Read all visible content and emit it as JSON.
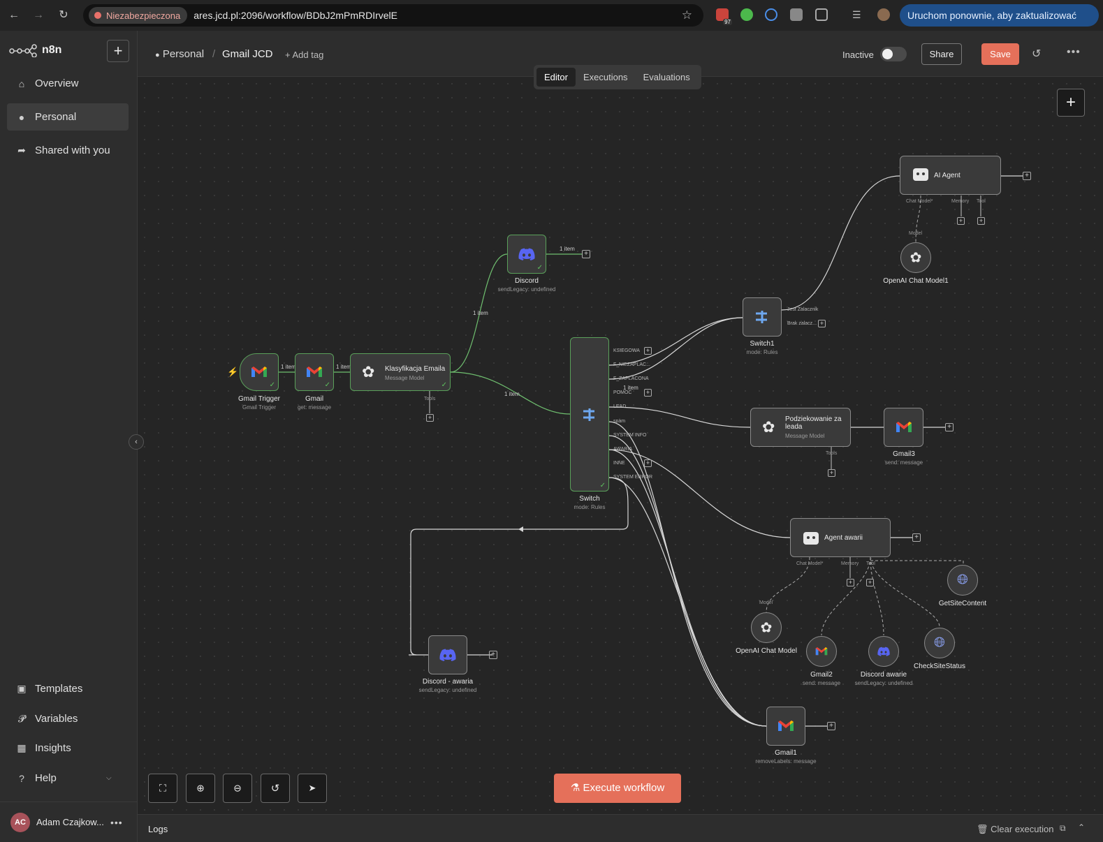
{
  "browser": {
    "insecure_label": "Niezabezpieczona",
    "url": "ares.jcd.pl:2096/workflow/BDbJ2mPmRDIrvelE",
    "update_button": "Uruchom ponownie, aby zaktualizować",
    "ext_badge": "97"
  },
  "sidebar": {
    "brand": "n8n",
    "items": [
      {
        "label": "Overview",
        "icon": "home-icon"
      },
      {
        "label": "Personal",
        "icon": "user-icon"
      },
      {
        "label": "Shared with you",
        "icon": "share-icon"
      }
    ],
    "bottom_items": [
      {
        "label": "Templates",
        "icon": "templates-icon"
      },
      {
        "label": "Variables",
        "icon": "variables-icon"
      },
      {
        "label": "Insights",
        "icon": "insights-icon"
      },
      {
        "label": "Help",
        "icon": "help-icon"
      }
    ],
    "user": {
      "initials": "AC",
      "name": "Adam Czajkow..."
    }
  },
  "header": {
    "breadcrumb_project": "Personal",
    "separator": "/",
    "workflow_name": "Gmail JCD",
    "add_tag": "+ Add tag",
    "status_label": "Inactive",
    "share_label": "Share",
    "save_label": "Save"
  },
  "tabs": [
    "Editor",
    "Executions",
    "Evaluations"
  ],
  "nodes": {
    "gmail_trigger": {
      "title": "Gmail Trigger",
      "sub": "Gmail Trigger"
    },
    "gmail": {
      "title": "Gmail",
      "sub": "get: message"
    },
    "klasyfikacja": {
      "title": "Klasyfikacja Emaila",
      "sub": "Message Model",
      "tools": "Tools"
    },
    "discord": {
      "title": "Discord",
      "sub": "sendLegacy: undefined"
    },
    "switch": {
      "title": "Switch",
      "sub": "mode: Rules",
      "outputs": [
        "KSIEGOWA",
        "F_NIEZAPLAC...",
        "F_ZAPLACONA",
        "POMOC",
        "LEAD",
        "spam",
        "SYSTEM INFO",
        "AWARIA",
        "INNE",
        "SYSTEM ERROR"
      ]
    },
    "switch1": {
      "title": "Switch1",
      "sub": "mode: Rules",
      "outputs": [
        "Jest Zalacznik",
        "Brak zalacz..."
      ]
    },
    "ai_agent": {
      "title": "AI Agent",
      "ports": [
        "Chat Model*",
        "Memory",
        "Tool"
      ]
    },
    "openai_chat_model1": {
      "title": "OpenAI Chat Model1",
      "port": "Model"
    },
    "podziekowanie": {
      "title": "Podziekowanie za leada",
      "sub": "Message Model",
      "tools": "Tools"
    },
    "gmail3": {
      "title": "Gmail3",
      "sub": "send: message"
    },
    "agent_awarii": {
      "title": "Agent awarii",
      "ports": [
        "Chat Model*",
        "Memory",
        "Tool"
      ]
    },
    "getsitecontent": {
      "title": "GetSiteContent"
    },
    "openai_chat_model": {
      "title": "OpenAI Chat Model",
      "port": "Model"
    },
    "gmail2": {
      "title": "Gmail2",
      "sub": "send: message"
    },
    "discord_awarie": {
      "title": "Discord awarie",
      "sub": "sendLegacy: undefined"
    },
    "checksitestatus": {
      "title": "CheckSiteStatus"
    },
    "discord_awaria": {
      "title": "Discord - awaria",
      "sub": "sendLegacy: undefined"
    },
    "gmail1": {
      "title": "Gmail1",
      "sub": "removeLabels: message"
    }
  },
  "edge_labels": {
    "one_item": "1 item"
  },
  "controls": {
    "execute_label": "Execute workflow"
  },
  "logs": {
    "label": "Logs",
    "clear_label": "Clear execution"
  },
  "colors": {
    "accent": "#e5705a",
    "success": "#5aa05a",
    "discord": "#5865f2"
  }
}
